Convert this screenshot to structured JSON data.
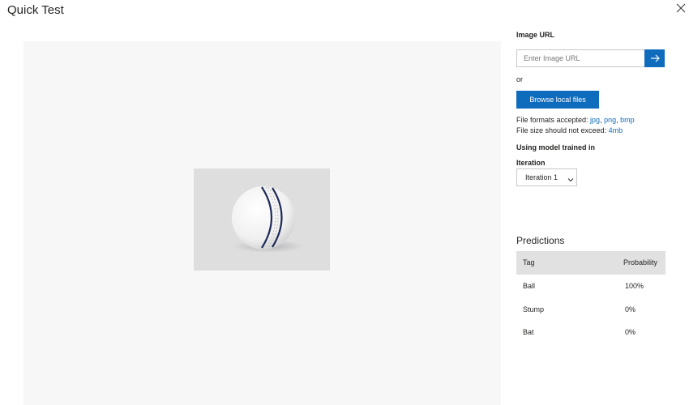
{
  "header": {
    "title": "Quick Test",
    "close_icon": "close-icon"
  },
  "form": {
    "image_url_label": "Image URL",
    "url_placeholder": "Enter Image URL",
    "submit_icon": "arrow-right-icon",
    "or_text": "or",
    "browse_label": "Browse local files",
    "formats_prefix": "File formats accepted: ",
    "formats": [
      "jpg",
      "png",
      "bmp"
    ],
    "size_prefix": "File size should not exceed: ",
    "size_limit": "4mb",
    "model_label": "Using model trained in",
    "iteration_label": "Iteration",
    "iteration_selected": "Iteration 1"
  },
  "predictions": {
    "title": "Predictions",
    "columns": [
      "Tag",
      "Probability"
    ],
    "rows": [
      {
        "tag": "Ball",
        "probability": "100%"
      },
      {
        "tag": "Stump",
        "probability": "0%"
      },
      {
        "tag": "Bat",
        "probability": "0%"
      }
    ]
  },
  "colors": {
    "accent": "#0f6cbd",
    "header_bg": "#e1e1e1",
    "preview_bg": "#f7f7f7"
  }
}
